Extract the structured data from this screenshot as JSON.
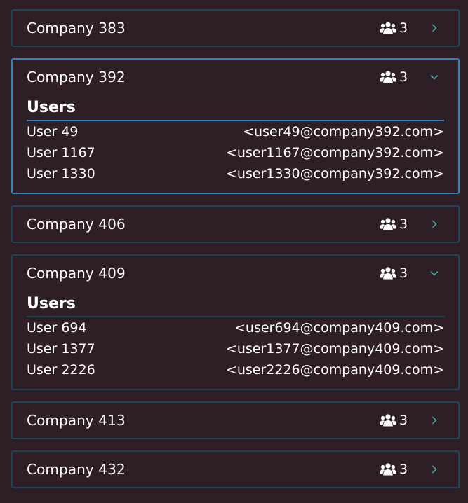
{
  "colors": {
    "background": "#2e1f26",
    "border": "#1d4559",
    "accent": "#2b86bd",
    "chevron": "#3fa7a0",
    "text": "#ffffff"
  },
  "icons": {
    "count": "users-group-icon",
    "collapsed": "chevron-right-icon",
    "expanded": "chevron-down-icon"
  },
  "companies": [
    {
      "name": "Company 383",
      "user_count": "3",
      "expanded": false
    },
    {
      "name": "Company 392",
      "user_count": "3",
      "expanded": true,
      "selected": true,
      "users_heading": "Users",
      "users": [
        {
          "name": "User 49",
          "email": "<user49@company392.com>"
        },
        {
          "name": "User 1167",
          "email": "<user1167@company392.com>"
        },
        {
          "name": "User 1330",
          "email": "<user1330@company392.com>"
        }
      ]
    },
    {
      "name": "Company 406",
      "user_count": "3",
      "expanded": false
    },
    {
      "name": "Company 409",
      "user_count": "3",
      "expanded": true,
      "users_heading": "Users",
      "users": [
        {
          "name": "User 694",
          "email": "<user694@company409.com>"
        },
        {
          "name": "User 1377",
          "email": "<user1377@company409.com>"
        },
        {
          "name": "User 2226",
          "email": "<user2226@company409.com>"
        }
      ]
    },
    {
      "name": "Company 413",
      "user_count": "3",
      "expanded": false
    },
    {
      "name": "Company 432",
      "user_count": "3",
      "expanded": false
    }
  ]
}
